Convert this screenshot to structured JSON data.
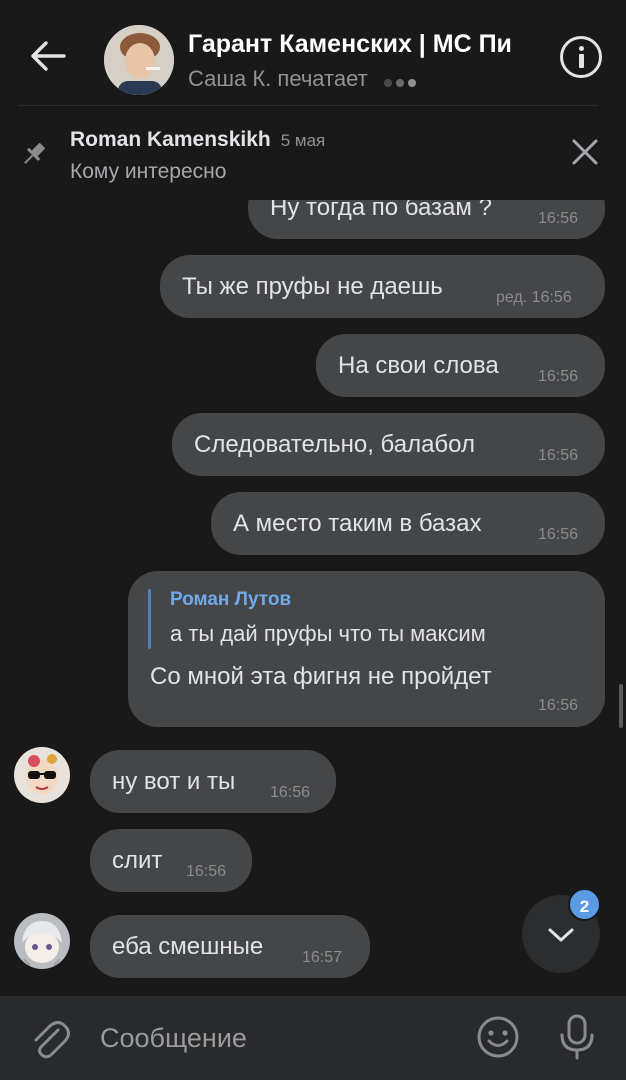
{
  "header": {
    "title": "Гарант Каменских | МС Пи",
    "status": "Саша К. печатает"
  },
  "pinned": {
    "author": "Roman Kamenskikh",
    "date": "5 мая",
    "text": "Кому интересно"
  },
  "messages": [
    {
      "text": "Ну тогда по базам ?",
      "time": "16:56",
      "side": "out"
    },
    {
      "text": "Ты же пруфы не даешь",
      "time": "ред. 16:56",
      "side": "out"
    },
    {
      "text": "На свои слова",
      "time": "16:56",
      "side": "out"
    },
    {
      "text": "Следовательно,  балабол",
      "time": "16:56",
      "side": "out"
    },
    {
      "text": "А место таким в базах",
      "time": "16:56",
      "side": "out"
    },
    {
      "reply_author": "Роман Лутов",
      "reply_text": "а ты дай пруфы что ты максим",
      "text": "Со мной эта фигня не пройдет",
      "time": "16:56",
      "side": "out"
    },
    {
      "text": "ну вот и ты",
      "time": "16:56",
      "side": "in"
    },
    {
      "text": "слит",
      "time": "16:56",
      "side": "in"
    },
    {
      "text": "еба смешные",
      "time": "16:57",
      "side": "in"
    }
  ],
  "unread_badge": "2",
  "composer": {
    "placeholder": "Сообщение"
  },
  "colors": {
    "background": "#19191a",
    "bubble": "#454647",
    "accent": "#5b9be6",
    "reply_name": "#71aaeb"
  },
  "icons": [
    "arrow-left-icon",
    "info-icon",
    "pin-icon",
    "close-icon",
    "chevron-down-icon",
    "paperclip-icon",
    "emoji-icon",
    "microphone-icon"
  ]
}
